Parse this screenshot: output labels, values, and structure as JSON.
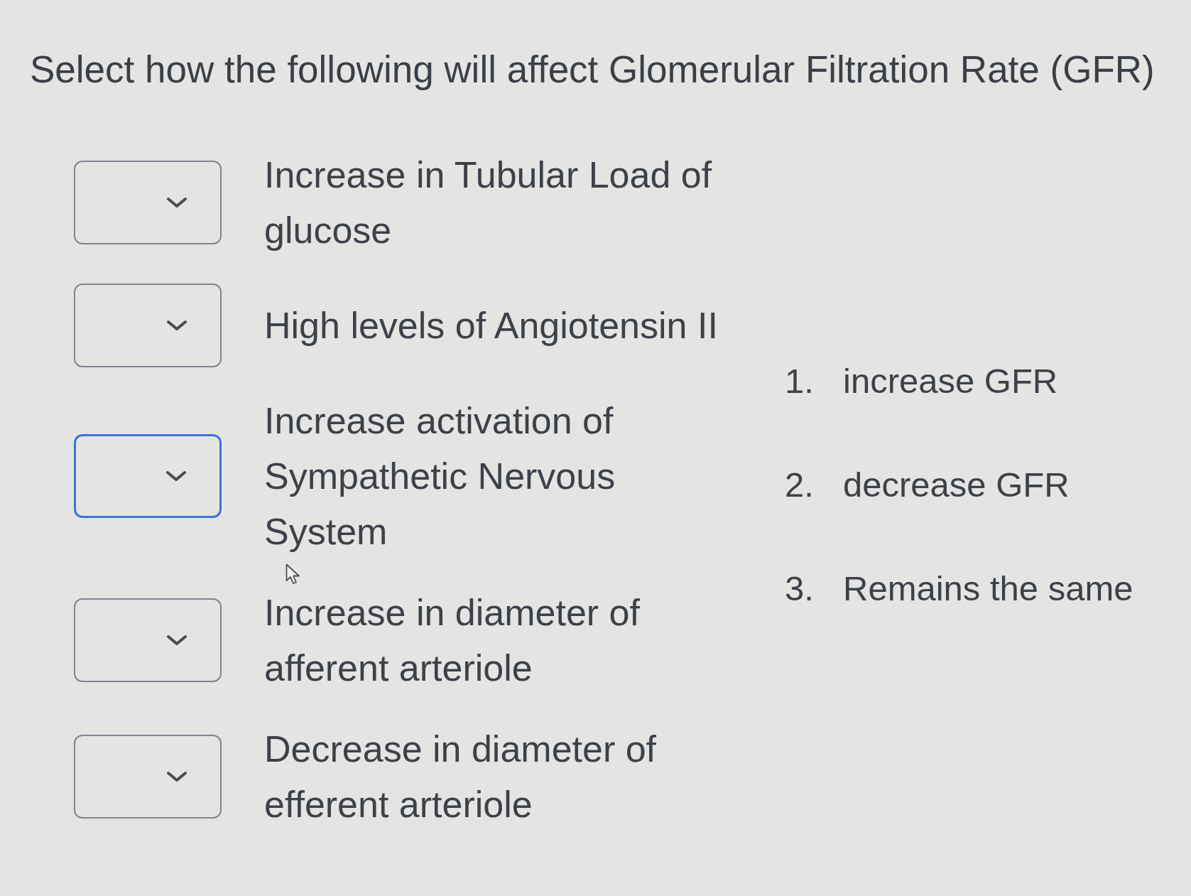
{
  "title": "Select how the following will affect Glomerular Filtration Rate (GFR)",
  "items": [
    {
      "label": "Increase in Tubular Load of glucose",
      "focused": false
    },
    {
      "label": "High levels of Angiotensin II",
      "focused": false
    },
    {
      "label": "Increase activation of Sympathetic Nervous System",
      "focused": true
    },
    {
      "label": "Increase in diameter of afferent arteriole",
      "focused": false
    },
    {
      "label": "Decrease in diameter of efferent arteriole",
      "focused": false
    }
  ],
  "options": [
    {
      "number": "1.",
      "text": "increase GFR"
    },
    {
      "number": "2.",
      "text": "decrease GFR"
    },
    {
      "number": "3.",
      "text": "Remains the same"
    }
  ]
}
